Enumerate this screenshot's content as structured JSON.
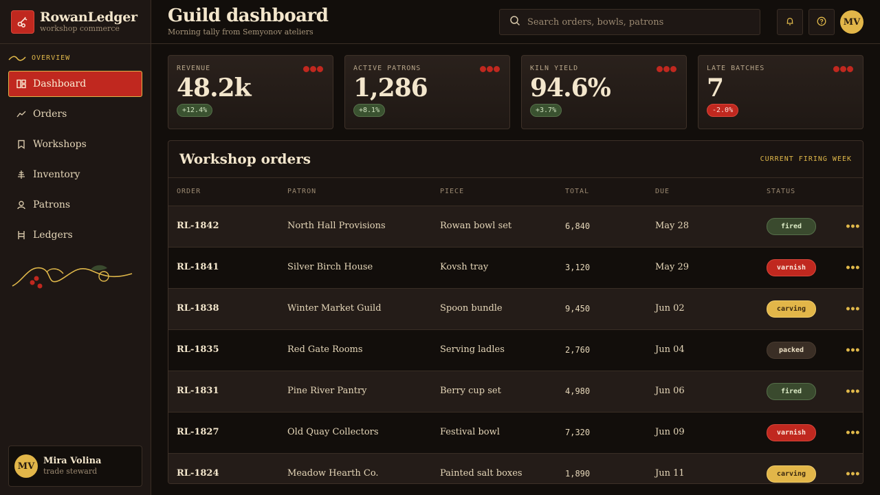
{
  "brand": {
    "name": "RowanLedger",
    "subtitle": "workshop commerce"
  },
  "sidebar": {
    "section_label": "OVERVIEW",
    "items": [
      {
        "label": "Dashboard",
        "icon": "dashboard-icon",
        "active": true
      },
      {
        "label": "Orders",
        "icon": "trend-icon"
      },
      {
        "label": "Workshops",
        "icon": "bookmark-icon"
      },
      {
        "label": "Inventory",
        "icon": "tree-icon"
      },
      {
        "label": "Patrons",
        "icon": "person-icon"
      },
      {
        "label": "Ledgers",
        "icon": "ledger-icon"
      }
    ]
  },
  "user": {
    "name": "Mira Volina",
    "role": "trade steward",
    "initials": "MV"
  },
  "header": {
    "title": "Guild dashboard",
    "subtitle": "Morning tally from Semyonov ateliers",
    "search_placeholder": "Search orders, bowls, patrons",
    "avatar_initials": "MV"
  },
  "stats": [
    {
      "label": "REVENUE",
      "value": "48.2k",
      "delta": "+12.4%",
      "trend": "up"
    },
    {
      "label": "ACTIVE PATRONS",
      "value": "1,286",
      "delta": "+8.1%",
      "trend": "up"
    },
    {
      "label": "KILN YIELD",
      "value": "94.6%",
      "delta": "+3.7%",
      "trend": "up"
    },
    {
      "label": "LATE BATCHES",
      "value": "7",
      "delta": "-2.0%",
      "trend": "down"
    }
  ],
  "orders": {
    "title": "Workshop orders",
    "tag": "CURRENT FIRING WEEK",
    "columns": [
      "ORDER",
      "PATRON",
      "PIECE",
      "TOTAL",
      "DUE",
      "STATUS"
    ],
    "rows": [
      {
        "order": "RL-1842",
        "patron": "North Hall Provisions",
        "piece": "Rowan bowl set",
        "total": "6,840",
        "due": "May 28",
        "status": "fired"
      },
      {
        "order": "RL-1841",
        "patron": "Silver Birch House",
        "piece": "Kovsh tray",
        "total": "3,120",
        "due": "May 29",
        "status": "varnish"
      },
      {
        "order": "RL-1838",
        "patron": "Winter Market Guild",
        "piece": "Spoon bundle",
        "total": "9,450",
        "due": "Jun 02",
        "status": "carving"
      },
      {
        "order": "RL-1835",
        "patron": "Red Gate Rooms",
        "piece": "Serving ladles",
        "total": "2,760",
        "due": "Jun 04",
        "status": "packed"
      },
      {
        "order": "RL-1831",
        "patron": "Pine River Pantry",
        "piece": "Berry cup set",
        "total": "4,980",
        "due": "Jun 06",
        "status": "fired"
      },
      {
        "order": "RL-1827",
        "patron": "Old Quay Collectors",
        "piece": "Festival bowl",
        "total": "7,320",
        "due": "Jun 09",
        "status": "varnish"
      },
      {
        "order": "RL-1824",
        "patron": "Meadow Hearth Co.",
        "piece": "Painted salt boxes",
        "total": "1,890",
        "due": "Jun 11",
        "status": "carving"
      }
    ]
  },
  "colors": {
    "accent_red": "#c0281f",
    "accent_gold": "#e2b649",
    "background": "#120e0b"
  }
}
